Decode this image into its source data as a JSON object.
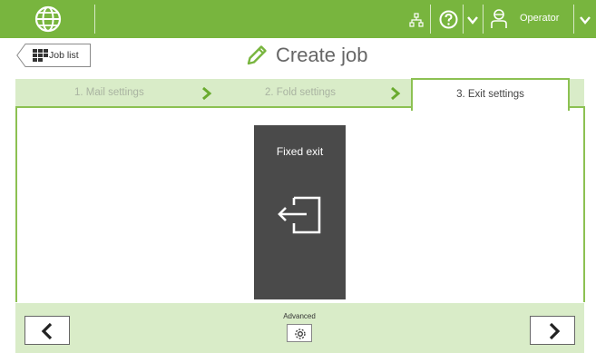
{
  "topbar": {
    "globe_icon": "globe-icon",
    "network_icon": "network-icon",
    "help_icon": "help-icon",
    "user_icon": "operator-icon",
    "user_label": "Operator"
  },
  "header": {
    "back_label": "Job list",
    "title": "Create job"
  },
  "steps": [
    {
      "label": "1. Mail settings"
    },
    {
      "label": "2. Fold settings"
    },
    {
      "label": "3. Exit settings"
    }
  ],
  "exit": {
    "label": "Fixed exit",
    "icon": "exit-icon"
  },
  "footer": {
    "advanced_label": "Advanced"
  },
  "colors": {
    "accent": "#78b53e",
    "light_accent": "#d9ecc8",
    "card": "#4a4a4a"
  }
}
